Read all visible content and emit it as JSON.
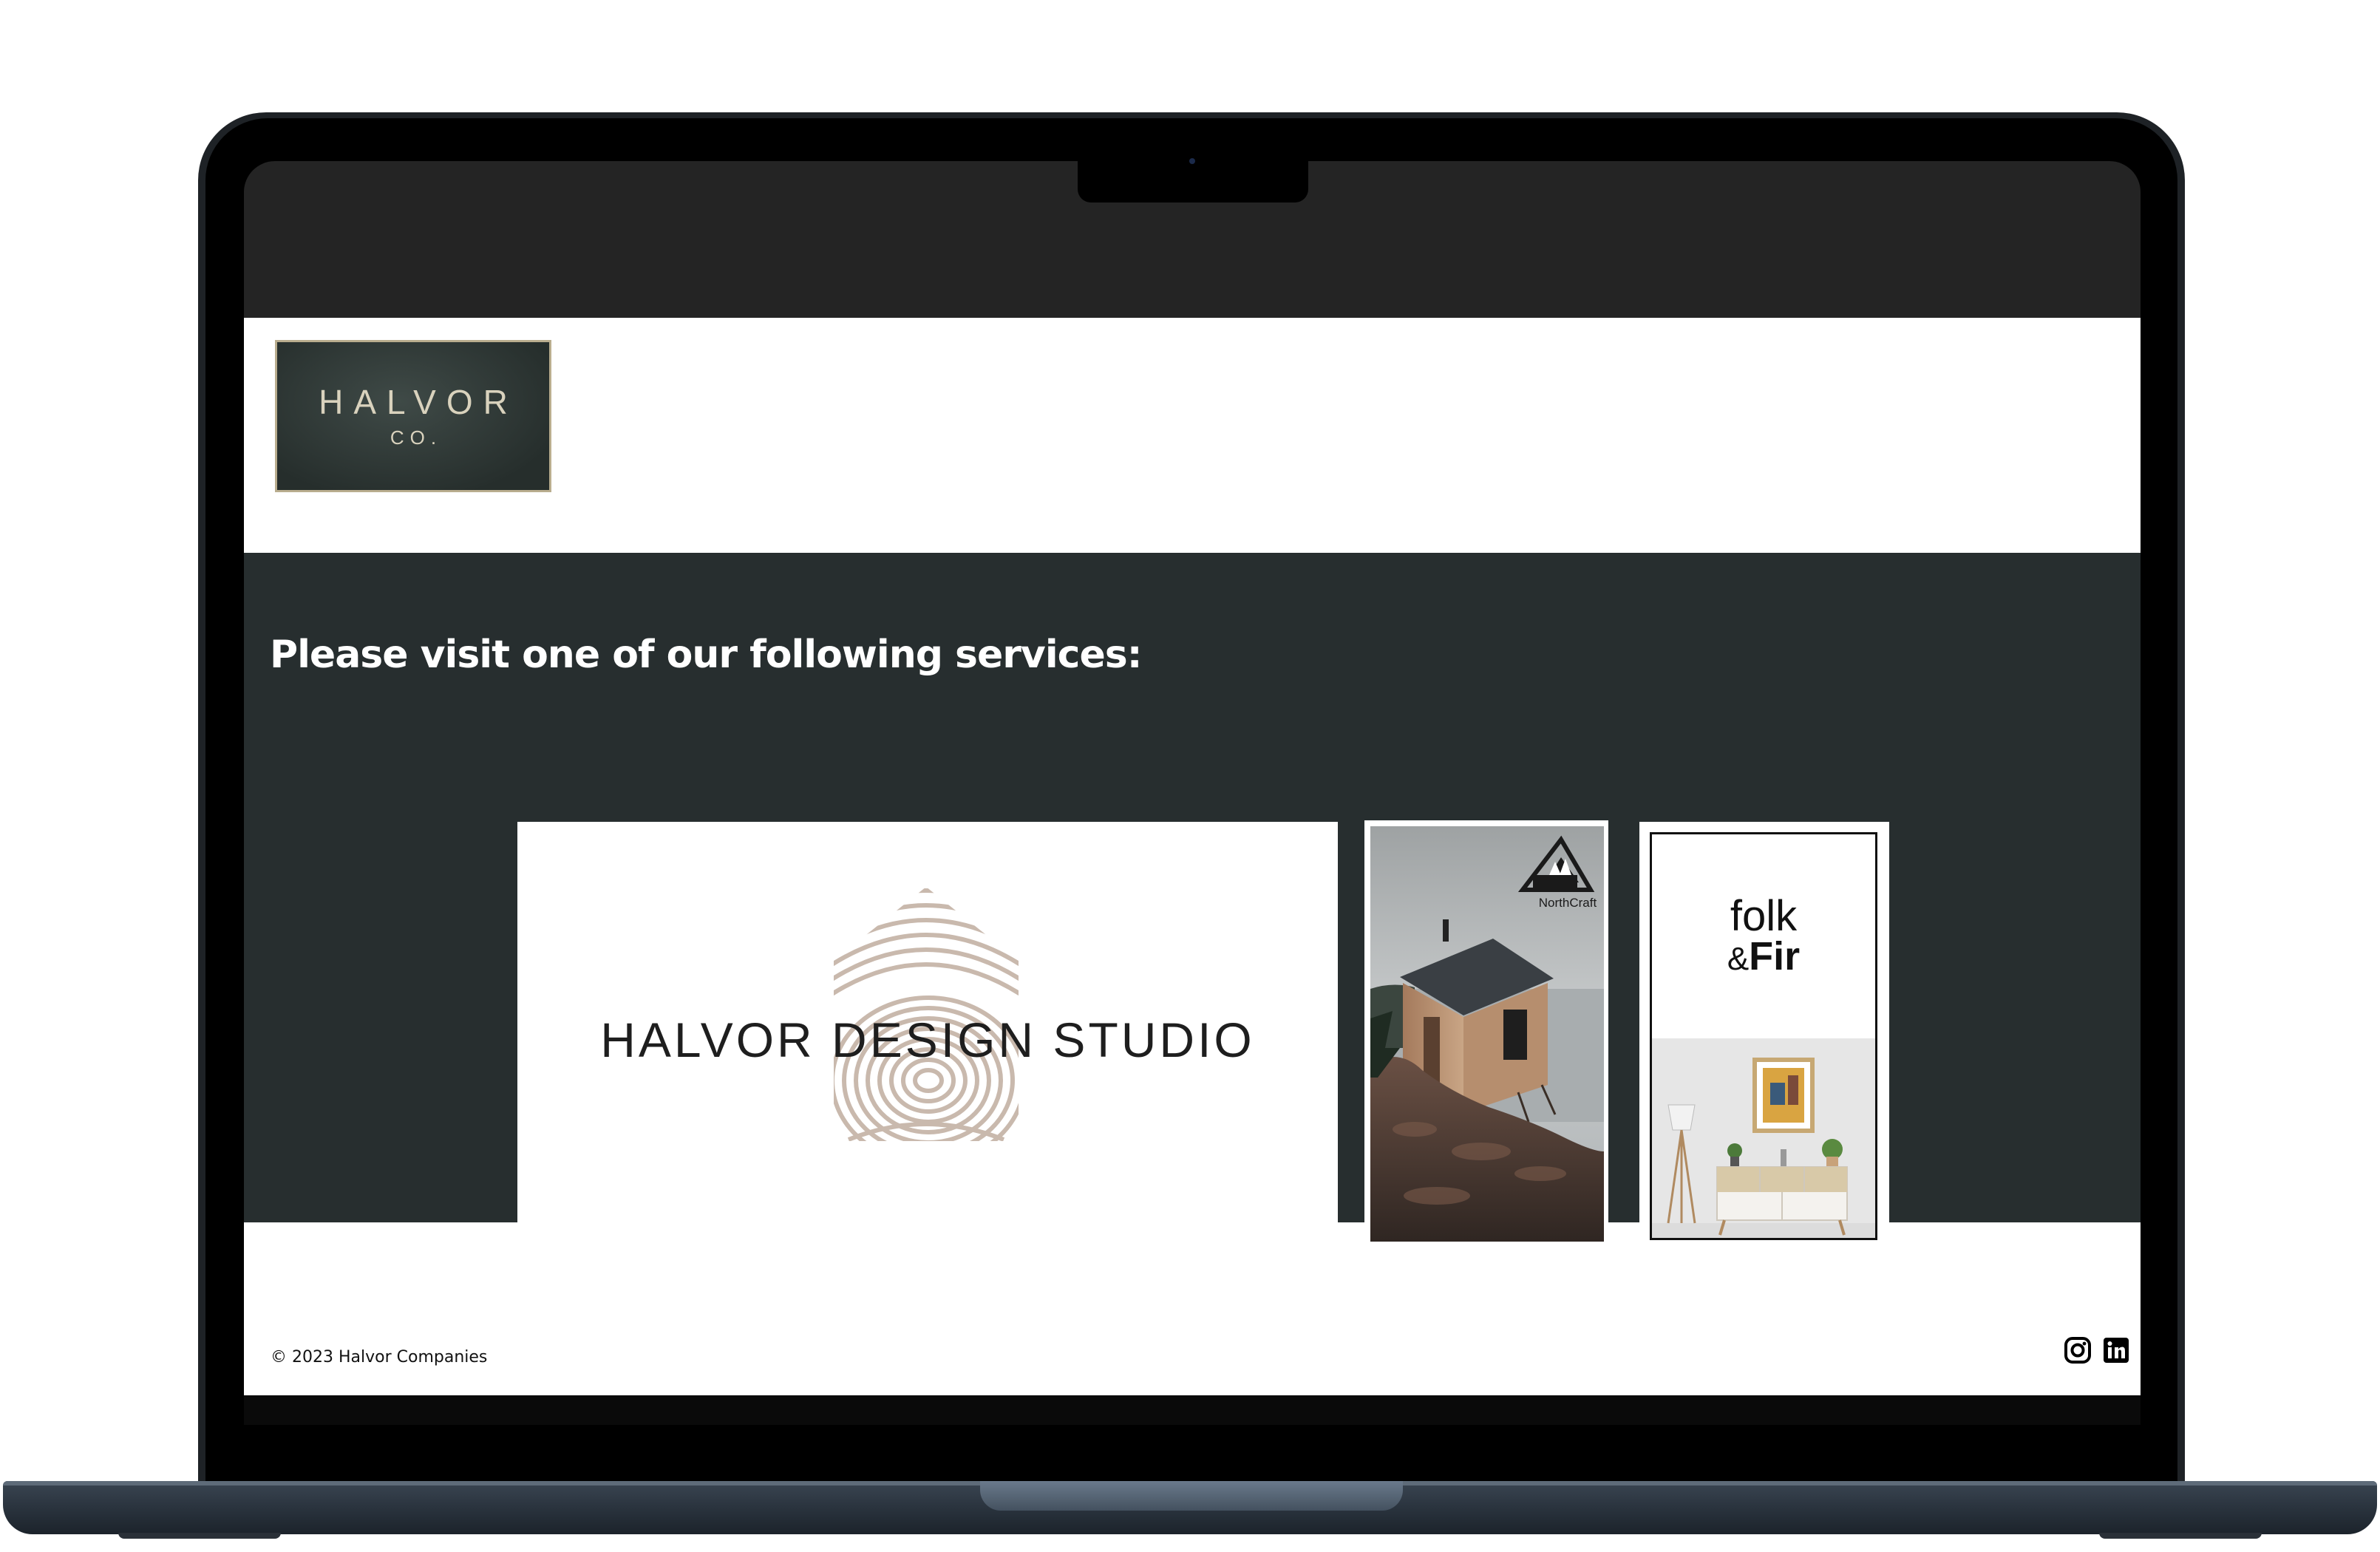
{
  "site": {
    "logo": {
      "main": "HALVOR",
      "sub": "CO."
    },
    "services_heading": "Please visit one of our following services:",
    "services": [
      {
        "name": "HALVOR DESIGN STUDIO"
      },
      {
        "name": "NorthCraft"
      },
      {
        "name_line1": "folk",
        "name_amp": "&",
        "name_fir": "Fir"
      }
    ],
    "footer": {
      "copyright": "© 2023 Halvor Companies",
      "social": [
        "instagram-icon",
        "linkedin-icon"
      ]
    }
  },
  "colors": {
    "services_bg": "#272e2f",
    "logo_bg": "#2f3836",
    "logo_border": "#b9ad8e",
    "laptop_base": "#27303a"
  }
}
